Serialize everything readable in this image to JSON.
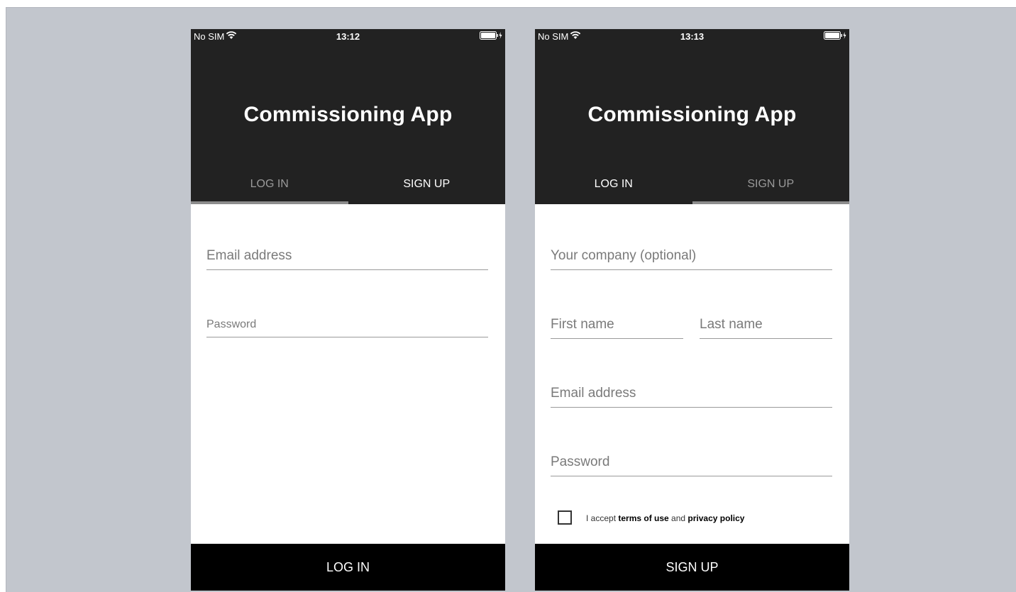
{
  "app_title": "Commissioning App",
  "login_screen": {
    "status": {
      "carrier": "No SIM",
      "time": "13:12"
    },
    "tabs": {
      "login": "LOG IN",
      "signup": "SIGN UP"
    },
    "fields": {
      "email": "Email address",
      "password": "Password"
    },
    "button": "LOG IN"
  },
  "signup_screen": {
    "status": {
      "carrier": "No SIM",
      "time": "13:13"
    },
    "tabs": {
      "login": "LOG IN",
      "signup": "SIGN UP"
    },
    "fields": {
      "company": "Your company (optional)",
      "first_name": "First name",
      "last_name": "Last name",
      "email": "Email address",
      "password": "Password"
    },
    "terms": {
      "prefix": "I accept ",
      "terms_link": "terms of use",
      "middle": " and ",
      "privacy_link": "privacy policy",
      "checked": false
    },
    "button": "SIGN UP"
  },
  "icons": {
    "wifi": "wifi-icon",
    "battery": "battery-charging-icon"
  },
  "colors": {
    "header": "#222222",
    "button": "#000000",
    "background": "#c2c6cd"
  }
}
